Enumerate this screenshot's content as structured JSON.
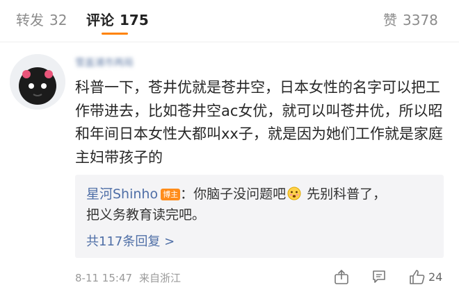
{
  "tabs": {
    "repost": {
      "label": "转发",
      "count": "32"
    },
    "comments": {
      "label": "评论",
      "count": "175"
    },
    "likes": {
      "label": "赞",
      "count": "3378"
    }
  },
  "comment": {
    "username": "雪盖浦市两局",
    "text": "科普一下，苍井优就是苍井空，日本女性的名字可以把工作带进去，比如苍井空ac女优，就可以叫苍井优，所以昭和年间日本女性大都叫xx子，就是因为她们工作就是家庭主妇带孩子的",
    "reply": {
      "author": "星河Shinho",
      "badge": "博主",
      "text_before_emoji": "：你脑子没问题吧",
      "text_after_emoji": " 先别科普了，",
      "text_line2": "把义务教育读完吧。"
    },
    "more_replies": "共117条回复 >",
    "timestamp": "8-11 15:47",
    "location": "来自浙江",
    "like_count": "24"
  },
  "colors": {
    "accent": "#ff8200",
    "link": "#4e6ea6",
    "badge": "#ff8c1a"
  },
  "icons": [
    "share-icon",
    "comment-icon",
    "thumbs-up-icon",
    "embarrassed-emoji"
  ]
}
